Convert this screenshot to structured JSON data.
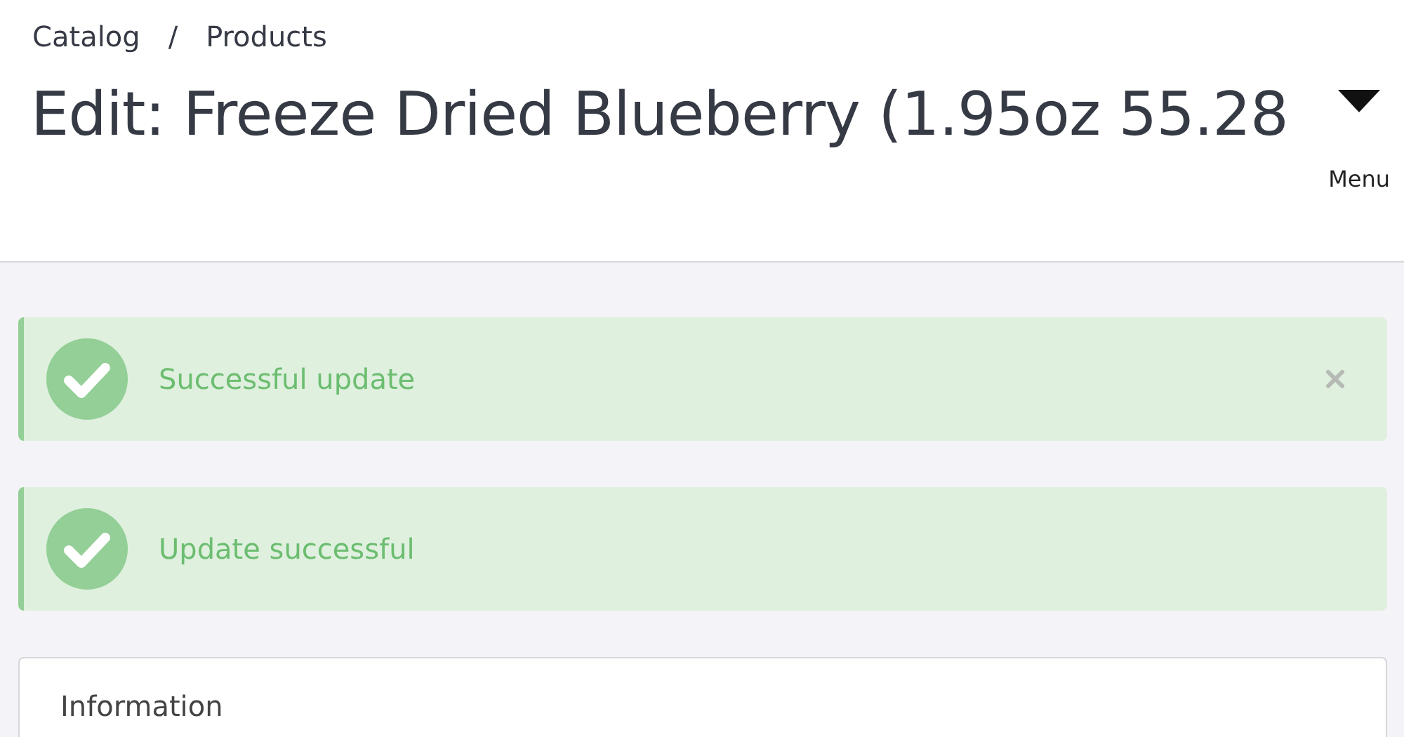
{
  "breadcrumb": [
    {
      "label": "Catalog"
    },
    {
      "label": "Products"
    }
  ],
  "breadcrumb_separator": "/",
  "title": "Edit: Freeze Dried Blueberry (1.95oz 55.28",
  "menu": {
    "label": "Menu"
  },
  "alerts": [
    {
      "kind": "success",
      "message": "Successful update",
      "dismissible": true
    },
    {
      "kind": "success",
      "message": "Update successful",
      "dismissible": false
    }
  ],
  "card": {
    "title": "Information"
  }
}
